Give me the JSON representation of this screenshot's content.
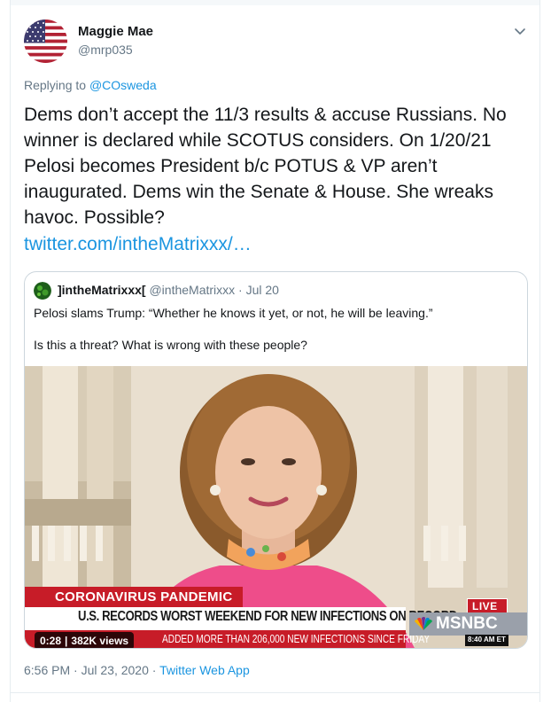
{
  "tweet": {
    "author_name": "Maggie Mae",
    "author_handle": "@mrp035",
    "replying_prefix": "Replying to",
    "replying_to": "@COsweda",
    "text": "Dems don’t accept the 11/3 results & accuse Russians. No winner is declared while SCOTUS considers. On 1/20/21 Pelosi becomes President b/c POTUS & VP aren’t inaugurated. Dems win the Senate & House. She wreaks havoc. Possible?",
    "link": "twitter.com/intheMatrixxx/…",
    "timestamp": "6:56 PM · Jul 23, 2020",
    "separator": " · ",
    "source_app": "Twitter Web App"
  },
  "quoted_tweet": {
    "author_name": "]intheMatrixxx[",
    "author_handle": "@intheMatrixxx",
    "meta_separator": " · ",
    "date": "Jul 20",
    "line1": "Pelosi slams Trump: “Whether he knows it yet, or not, he will be leaving.”",
    "line2": "Is this a threat? What is wrong with these people?",
    "video": {
      "banner_top": "CORONAVIRUS PANDEMIC",
      "headline": "U.S. RECORDS WORST WEEKEND FOR NEW INFECTIONS ON RECORD",
      "subline": "ADDED MORE THAN 206,000 NEW INFECTIONS SINCE FRIDAY",
      "live_label": "LIVE",
      "network": "MSNBC",
      "clock": "8:40 AM ET",
      "duration": "0:28",
      "separator": "|",
      "views": "382K views"
    }
  },
  "colors": {
    "link_blue": "#1b95e0",
    "secondary_gray": "#657786",
    "msnbc_red": "#c71c28"
  },
  "icons": {
    "caret": "chevron-down-icon",
    "avatar": "us-flag-avatar",
    "quoted_avatar": "green-circle-avatar"
  }
}
